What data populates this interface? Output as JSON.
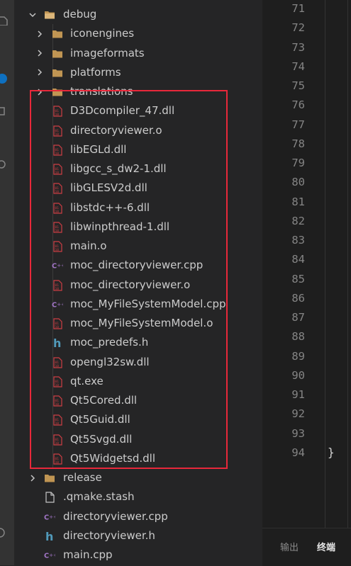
{
  "explorer": {
    "folders": {
      "debug": "debug",
      "iconengines": "iconengines",
      "imageformats": "imageformats",
      "platforms": "platforms",
      "translations": "translations",
      "release": "release"
    },
    "debug_files": [
      "D3Dcompiler_47.dll",
      "directoryviewer.o",
      "libEGLd.dll",
      "libgcc_s_dw2-1.dll",
      "libGLESV2d.dll",
      "libstdc++-6.dll",
      "libwinpthread-1.dll",
      "main.o",
      "moc_directoryviewer.cpp",
      "moc_directoryviewer.o",
      "moc_MyFileSystemModel.cpp",
      "moc_MyFileSystemModel.o",
      "moc_predefs.h",
      "opengl32sw.dll",
      "qt.exe",
      "Qt5Cored.dll",
      "Qt5Guid.dll",
      "Qt5Svgd.dll",
      "Qt5Widgetsd.dll"
    ],
    "root_files": [
      ".qmake.stash",
      "directoryviewer.cpp",
      "directoryviewer.h",
      "main.cpp"
    ]
  },
  "editor": {
    "line_numbers": [
      "71",
      "72",
      "73",
      "74",
      "75",
      "76",
      "77",
      "78",
      "79",
      "80",
      "81",
      "82",
      "83",
      "84",
      "85",
      "86",
      "87",
      "88",
      "89",
      "90",
      "91",
      "92",
      "93",
      "94"
    ],
    "closing_brace": "}"
  },
  "panel": {
    "tab_output": "输出",
    "tab_terminal": "终端"
  },
  "colors": {
    "highlight_box": "#e8283a",
    "folder": "#c09553",
    "cpp_icon": "#a074c4",
    "header_icon": "#519aba",
    "binary_icon": "#cc3e44"
  }
}
